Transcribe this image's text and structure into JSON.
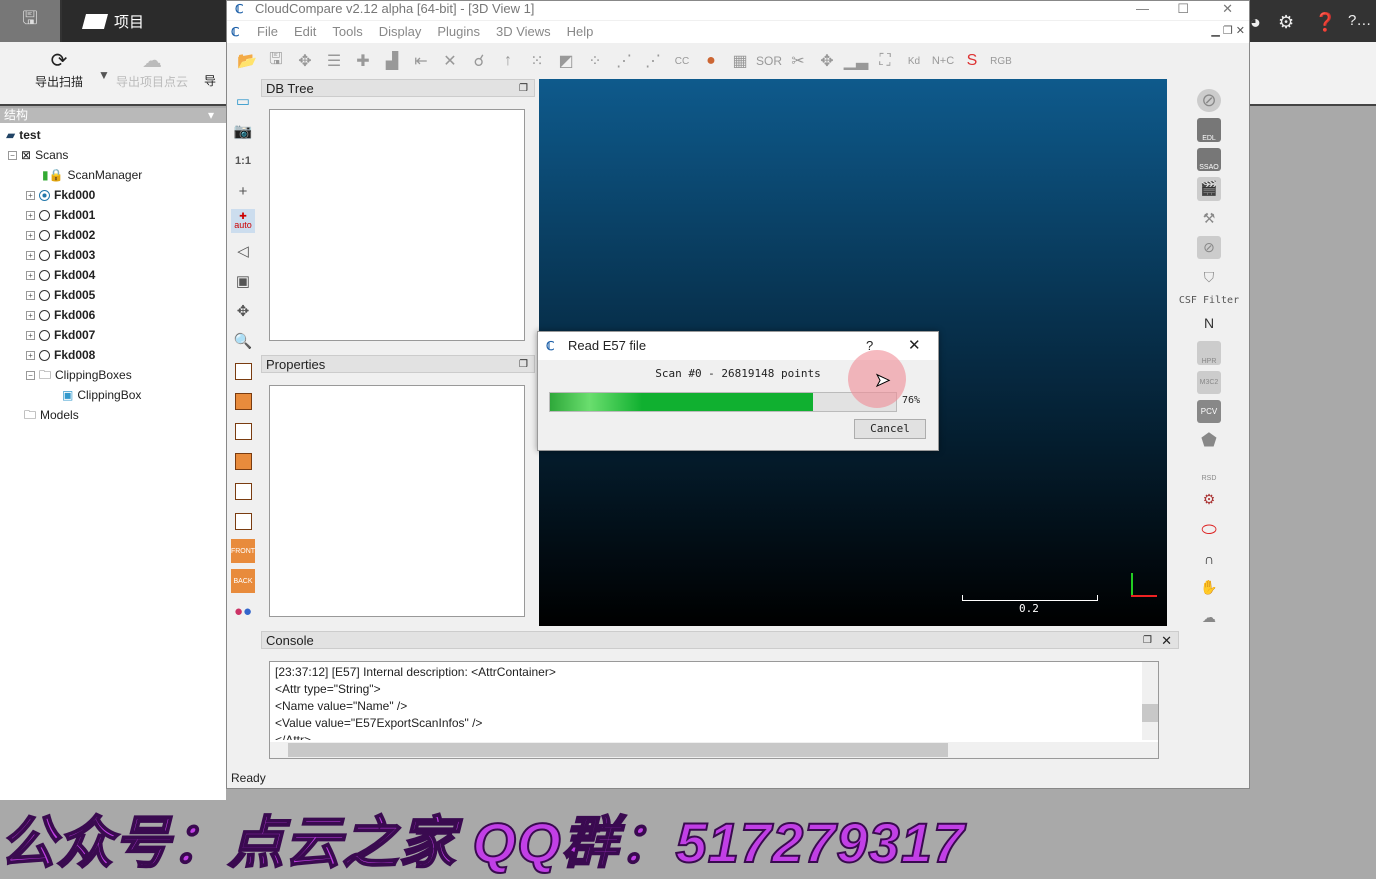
{
  "bg_app": {
    "tab_label": "项目",
    "ribbon": [
      "导出扫描",
      "导出项目点云",
      "导"
    ],
    "structure_header": "结构",
    "tree": [
      {
        "label": "test",
        "bold": true
      },
      {
        "label": "Scans"
      },
      {
        "label": "ScanManager"
      },
      {
        "label": "Fkd000",
        "bold": true
      },
      {
        "label": "Fkd001",
        "bold": true
      },
      {
        "label": "Fkd002",
        "bold": true
      },
      {
        "label": "Fkd003",
        "bold": true
      },
      {
        "label": "Fkd004",
        "bold": true
      },
      {
        "label": "Fkd005",
        "bold": true
      },
      {
        "label": "Fkd006",
        "bold": true
      },
      {
        "label": "Fkd007",
        "bold": true
      },
      {
        "label": "Fkd008",
        "bold": true
      },
      {
        "label": "ClippingBoxes"
      },
      {
        "label": "ClippingBox"
      },
      {
        "label": "Models"
      }
    ]
  },
  "window": {
    "title": "CloudCompare v2.12 alpha [64-bit] - [3D View 1]",
    "menus": [
      "File",
      "Edit",
      "Tools",
      "Display",
      "Plugins",
      "3D Views",
      "Help"
    ]
  },
  "panels": {
    "db_tree": "DB Tree",
    "properties": "Properties",
    "console": "Console"
  },
  "view": {
    "scale_label": "0.2"
  },
  "right_toolbar": {
    "edl": "EDL",
    "ssao": "SSAO",
    "csf": "CSF Filter",
    "n": "N",
    "hpr": "HPR",
    "pcv": "PCV",
    "rsd": "RSD",
    "m3c2": "M3C2"
  },
  "vtool": {
    "one_to_one": "1:1",
    "auto": "auto",
    "front": "FRONT",
    "back": "BACK"
  },
  "dialog": {
    "title": "Read E57 file",
    "help": "?",
    "message": "Scan #0 - 26819148 points",
    "progress": 76,
    "progress_label": "76%",
    "cancel": "Cancel"
  },
  "console_lines": [
    "[23:37:12] [E57] Internal description: <AttrContainer>",
    "<Attr type=\"String\">",
    "<Name value=\"Name\" />",
    "<Value value=\"E57ExportScanInfos\" />",
    "</Attr>"
  ],
  "status": "Ready",
  "watermark": "公众号：点云之家  QQ群：517279317",
  "colors": {
    "progress": "#10b030",
    "view_top": "#0e5a8c"
  }
}
